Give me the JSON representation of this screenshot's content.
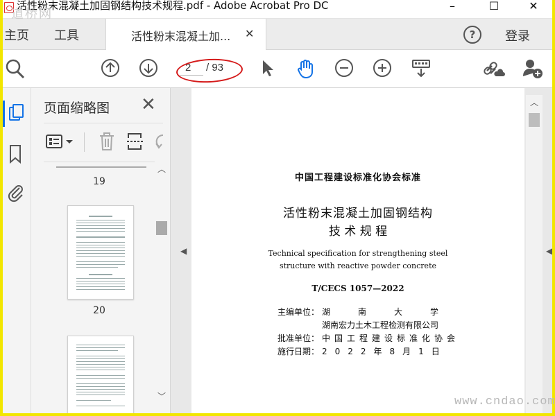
{
  "window": {
    "title": "活性粉末混凝土加固钢结构技术规程.pdf - Adobe Acrobat Pro DC",
    "watermark_top": "道桥网",
    "minimize": "–",
    "maximize": "☐",
    "close": "✕"
  },
  "tabs": {
    "home": "主页",
    "tools": "工具",
    "document": "活性粉末混凝土加...",
    "document_close": "✕",
    "help": "?",
    "signin": "登录"
  },
  "toolbar": {
    "current_page": "2",
    "total_pages": "/ 93",
    "icons": [
      "zoom-icon",
      "prev-page-icon",
      "next-page-icon",
      "select-cursor-icon",
      "hand-tool-icon",
      "zoom-out-icon",
      "zoom-in-icon",
      "keyboard-scroll-icon",
      "share-link-icon",
      "add-user-icon"
    ]
  },
  "rail": {
    "icons": [
      "page-thumbnails-icon",
      "bookmark-icon",
      "attachment-icon"
    ]
  },
  "thumb_panel": {
    "title": "页面缩略图",
    "close": "✕",
    "page_labels": [
      "19",
      "20"
    ]
  },
  "document_page": {
    "org_standard": "中国工程建设标准化协会标准",
    "title_line1": "活性粉末混凝土加固钢结构",
    "title_line2": "技 术 规 程",
    "english_line1": "Technical specification for strengthening steel",
    "english_line2": "structure with reactive powder concrete",
    "code": "T/CECS 1057—2022",
    "editor_label": "主编单位：",
    "editor_value1": "湖南大学",
    "editor_value2": "湖南宏力土木工程检测有限公司",
    "approver_label": "批准单位：",
    "approver_value": "中国工程建设标准化协会",
    "date_label": "施行日期：",
    "date_value": "2022年8月1日"
  },
  "watermark_bottom": "www.cndao.com",
  "colors": {
    "frame": "#f2e600",
    "annotation": "#d51a1a",
    "accent": "#1473e6"
  }
}
